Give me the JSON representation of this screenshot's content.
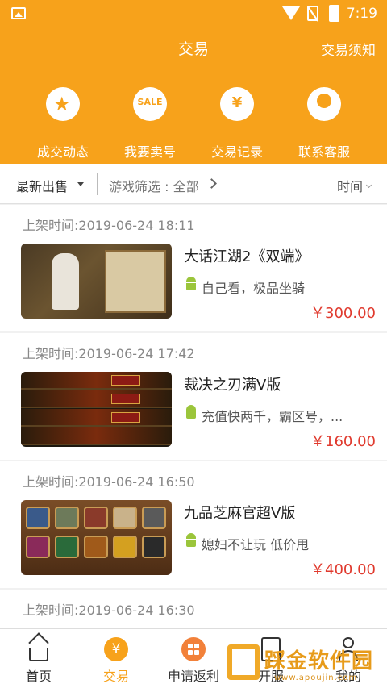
{
  "status_bar": {
    "time": "7:19"
  },
  "header": {
    "title": "交易",
    "notice_label": "交易须知"
  },
  "quick_actions": [
    {
      "label": "成交动态",
      "icon": "star-badge-icon"
    },
    {
      "label": "我要卖号",
      "icon": "sale-tag-icon",
      "badge_text": "SALE"
    },
    {
      "label": "交易记录",
      "icon": "yen-record-icon",
      "badge_text": "¥"
    },
    {
      "label": "联系客服",
      "icon": "headset-icon"
    }
  ],
  "filter": {
    "latest_label": "最新出售",
    "game_filter_label": "游戏筛选 : 全部",
    "time_label": "时间"
  },
  "listings": [
    {
      "date": "上架时间:2019-06-24 18:11",
      "title": "大话江湖2《双端》",
      "desc": "自己看，极品坐骑",
      "price": "￥300.00"
    },
    {
      "date": "上架时间:2019-06-24 17:42",
      "title": "裁决之刃满V版",
      "desc": "充值快两千，霸区号，...",
      "price": "￥160.00"
    },
    {
      "date": "上架时间:2019-06-24 16:50",
      "title": "九品芝麻官超V版",
      "desc": "媳妇不让玩 低价甩",
      "price": "￥400.00"
    },
    {
      "date": "上架时间:2019-06-24 16:30",
      "title": "",
      "desc": "",
      "price": ""
    }
  ],
  "bottom_nav": [
    {
      "label": "首页",
      "icon": "home-icon"
    },
    {
      "label": "交易",
      "icon": "yen-icon",
      "badge_text": "¥",
      "active": true
    },
    {
      "label": "申请返利",
      "icon": "grid-icon"
    },
    {
      "label": "开服",
      "icon": "document-icon"
    },
    {
      "label": "我的",
      "icon": "user-icon"
    }
  ],
  "watermark": {
    "text": "踩金软件园",
    "url": "www.apoujin.com"
  },
  "colors": {
    "accent": "#f7a21b",
    "price": "#e03a2e",
    "android": "#9bc53b"
  }
}
